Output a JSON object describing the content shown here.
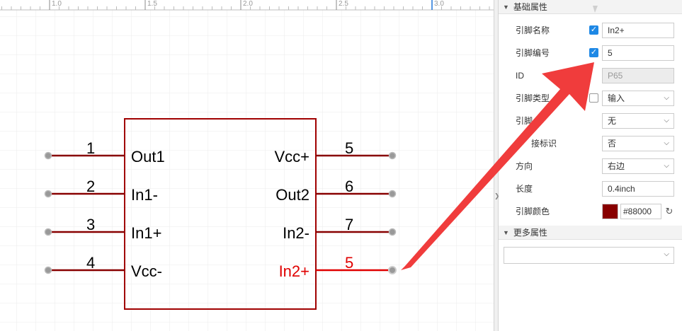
{
  "ruler": {
    "ticks": [
      "1.0",
      "1.5",
      "2.0",
      "2.5",
      "3.0"
    ]
  },
  "component": {
    "left_pins": [
      {
        "number": "1",
        "name": "Out1"
      },
      {
        "number": "2",
        "name": "In1-"
      },
      {
        "number": "3",
        "name": "In1+"
      },
      {
        "number": "4",
        "name": "Vcc-"
      }
    ],
    "right_pins": [
      {
        "number": "5",
        "name": "Vcc+"
      },
      {
        "number": "6",
        "name": "Out2"
      },
      {
        "number": "7",
        "name": "In2-"
      },
      {
        "number": "5",
        "name": "In2+",
        "selected": true
      }
    ],
    "body_color": "#a00000",
    "pin_color": "#880000",
    "selected_color": "#e00000"
  },
  "panel": {
    "basic_section": "基础属性",
    "more_section": "更多属性",
    "pin_name": {
      "label": "引脚名称",
      "checked": true,
      "value": "In2+"
    },
    "pin_number": {
      "label": "引脚编号",
      "checked": true,
      "value": "5"
    },
    "id": {
      "label": "ID",
      "value": "P65"
    },
    "pin_type": {
      "label": "引脚类型",
      "checked": false,
      "value": "输入"
    },
    "pin_shape": {
      "label": "引脚",
      "value": "无"
    },
    "connection_mark": {
      "label": "接标识",
      "value": "否"
    },
    "direction": {
      "label": "方向",
      "value": "右边"
    },
    "length": {
      "label": "长度",
      "value": "0.4inch"
    },
    "pin_color": {
      "label": "引脚颜色",
      "value": "#88000",
      "swatch": "#880000"
    },
    "more_select": {
      "value": ""
    }
  },
  "annotation": {
    "arrow_color": "#f03c3c"
  }
}
